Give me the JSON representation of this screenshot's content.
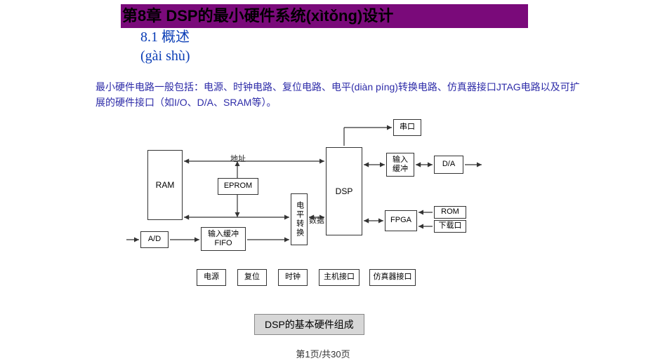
{
  "title": "第8章 DSP的最小硬件系统(xìtǒng)设计",
  "subtitle_line1": "8.1 概述",
  "subtitle_line2": "(gài shù)",
  "description": "最小硬件电路一般包括：电源、时钟电路、复位电路、电平(diàn píng)转换电路、仿真器接口JTAG电路以及可扩展的硬件接口（如I/O、D/A、SRAM等）。",
  "blocks": {
    "serial": "串口",
    "ram": "RAM",
    "eprom": "EPROM",
    "dsp": "DSP",
    "input_buf": "输入\n缓冲",
    "da": "D/A",
    "level": "电平转换",
    "fpga": "FPGA",
    "rom": "ROM",
    "download": "下载口",
    "ad": "A/D",
    "in_fifo": "输入缓冲\nFIFO",
    "power": "电源",
    "reset": "复位",
    "clock": "时钟",
    "host": "主机接口",
    "emu": "仿真器接口"
  },
  "edge_labels": {
    "addr": "地址",
    "data": "数据"
  },
  "caption": "DSP的基本硬件组成",
  "pager": "第1页/共30页"
}
